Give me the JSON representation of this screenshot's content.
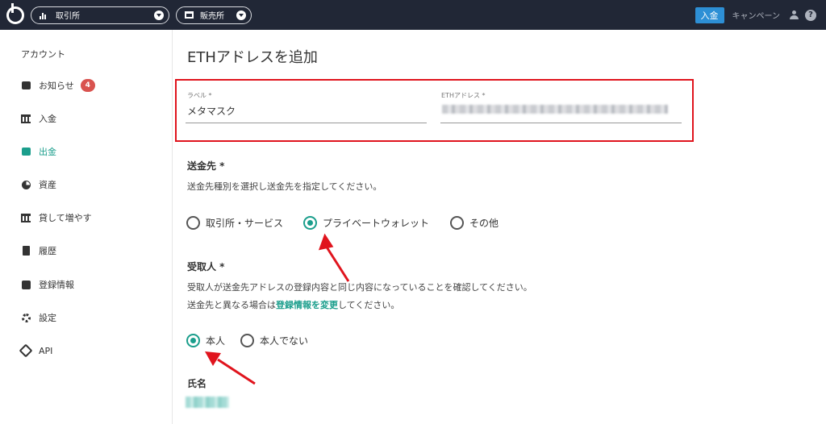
{
  "topbar": {
    "exchange_label": "取引所",
    "store_label": "販売所",
    "deposit_label": "入金",
    "campaign_label": "キャンペーン",
    "help_glyph": "?"
  },
  "sidebar": {
    "title": "アカウント",
    "items": [
      {
        "label": "お知らせ",
        "badge": "4"
      },
      {
        "label": "入金"
      },
      {
        "label": "出金"
      },
      {
        "label": "資産"
      },
      {
        "label": "貸して増やす"
      },
      {
        "label": "履歴"
      },
      {
        "label": "登録情報"
      },
      {
        "label": "設定"
      },
      {
        "label": "API"
      }
    ]
  },
  "main": {
    "title": "ETHアドレスを追加",
    "label_field": {
      "label": "ラベル *",
      "value": "メタマスク"
    },
    "address_field": {
      "label": "ETHアドレス *"
    },
    "destination": {
      "heading": "送金先 *",
      "description": "送金先種別を選択し送金先を指定してください。",
      "options": [
        "取引所・サービス",
        "プライベートウォレット",
        "その他"
      ]
    },
    "recipient": {
      "heading": "受取人 *",
      "line1": "受取人が送金先アドレスの登録内容と同じ内容になっていることを確認してください。",
      "line2_before": "送金先と異なる場合は",
      "line2_link": "登録情報を変更",
      "line2_after": "してください。",
      "options": [
        "本人",
        "本人でない"
      ]
    },
    "name": {
      "heading": "氏名"
    }
  },
  "colors": {
    "accent": "#1b9e8c",
    "highlight": "#e0141d",
    "topbar": "#212736"
  }
}
